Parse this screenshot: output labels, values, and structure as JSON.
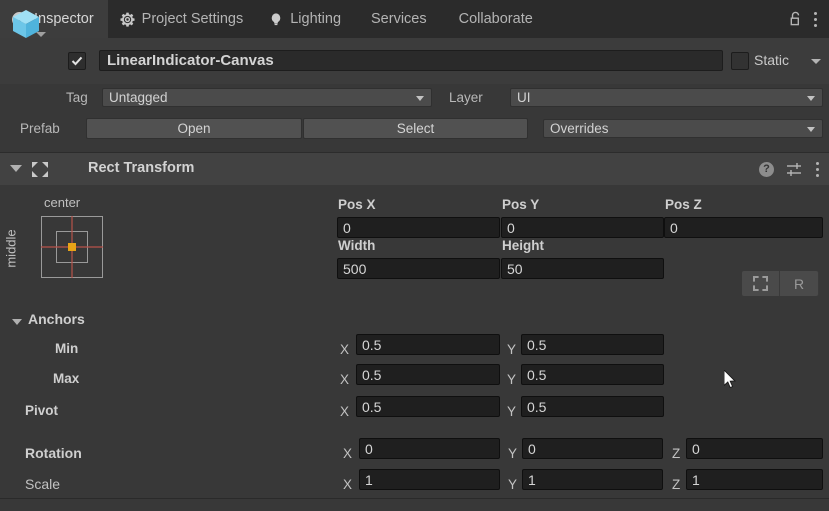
{
  "tabs": [
    {
      "label": "Inspector",
      "icon": "info-icon",
      "active": true
    },
    {
      "label": "Project Settings",
      "icon": "gear-icon",
      "active": false
    },
    {
      "label": "Lighting",
      "icon": "lightbulb-icon",
      "active": false
    },
    {
      "label": "Services",
      "icon": "",
      "active": false
    },
    {
      "label": "Collaborate",
      "icon": "",
      "active": false
    }
  ],
  "tabbar_right": {
    "lock_icon": "unlocked-padlock-icon",
    "menu_icon": "kebab-menu-icon"
  },
  "object_header": {
    "icon": "gameobject-cube-icon",
    "enabled": true,
    "name": "LinearIndicator-Canvas",
    "static_label": "Static",
    "static_checked": false
  },
  "tag_row": {
    "tag_label": "Tag",
    "tag_value": "Untagged",
    "layer_label": "Layer",
    "layer_value": "UI"
  },
  "prefab_row": {
    "label": "Prefab",
    "open_label": "Open",
    "select_label": "Select",
    "overrides_label": "Overrides"
  },
  "component": {
    "title": "Rect Transform",
    "icon": "rect-transform-icon",
    "help_glyph": "?",
    "expanded": true
  },
  "anchor_preset": {
    "top_label": "center",
    "left_label": "middle",
    "pivot_color": "#e8a317",
    "guide_color": "#b8524a"
  },
  "rect": {
    "pos_x_label": "Pos X",
    "pos_x_value": "0",
    "pos_y_label": "Pos Y",
    "pos_y_value": "0",
    "pos_z_label": "Pos Z",
    "pos_z_value": "0",
    "width_label": "Width",
    "width_value": "500",
    "height_label": "Height",
    "height_value": "50",
    "blueprint_glyph": "",
    "raw_glyph": "R"
  },
  "anchors": {
    "section_label": "Anchors",
    "min_label": "Min",
    "min_x_axis": "X",
    "min_x_value": "0.5",
    "min_y_axis": "Y",
    "min_y_value": "0.5",
    "max_label": "Max",
    "max_x_axis": "X",
    "max_x_value": "0.5",
    "max_y_axis": "Y",
    "max_y_value": "0.5"
  },
  "pivot": {
    "label": "Pivot",
    "x_axis": "X",
    "x_value": "0.5",
    "y_axis": "Y",
    "y_value": "0.5"
  },
  "rotation": {
    "label": "Rotation",
    "x_axis": "X",
    "x_value": "0",
    "y_axis": "Y",
    "y_value": "0",
    "z_axis": "Z",
    "z_value": "0"
  },
  "scale": {
    "label": "Scale",
    "x_axis": "X",
    "x_value": "1",
    "y_axis": "Y",
    "y_value": "1",
    "z_axis": "Z",
    "z_value": "1"
  },
  "colors": {
    "panel_bg": "#383838",
    "tabbar_bg": "#2b2b2b",
    "field_bg": "#1f1f1f",
    "cube_blue": "#7fd3f0"
  }
}
